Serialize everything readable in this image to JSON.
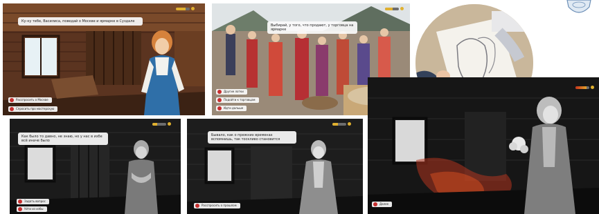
{
  "header": {
    "fragment": ""
  },
  "panels": [
    {
      "id": "izba-color",
      "dialogue": "Ку-ку тебе, Василиса, поведай о Москве и ярмарке в Суздале",
      "choices": [
        "Расспросить о Москве",
        "Спросить про мастерскую"
      ],
      "meter_level": 0.7
    },
    {
      "id": "fair",
      "dialogue": "Выбирай, у того, что продают, у торговца на ярмарке",
      "choices": [
        "Другие лотки",
        "Подойти к торговцам",
        "Идти дальше"
      ],
      "meter_level": 0.55
    },
    {
      "id": "izba-bw-1",
      "dialogue": "Как было то давно, не знаю, но у нас в избе всё иначе было",
      "choices": [
        "Задать вопрос",
        "Уйти из избы"
      ],
      "meter_level": 0.35
    },
    {
      "id": "izba-bw-2",
      "dialogue": "Бывало, как о прежних временах вспомнишь, так тоскливо становится",
      "choices": [
        "Расспросить о прошлом"
      ],
      "meter_level": 0.4
    },
    {
      "id": "ghost",
      "dialogue": "",
      "choices": [
        "Далее"
      ],
      "meter_level": 0.8
    }
  ],
  "colors": {
    "choice_dot": "#c62e2e",
    "meter_fill": "#e0b02f",
    "bubble_bg": "#fafafa"
  },
  "icons": [
    "choice-dot-icon",
    "meter-indicator-icon",
    "emblem-icon"
  ]
}
